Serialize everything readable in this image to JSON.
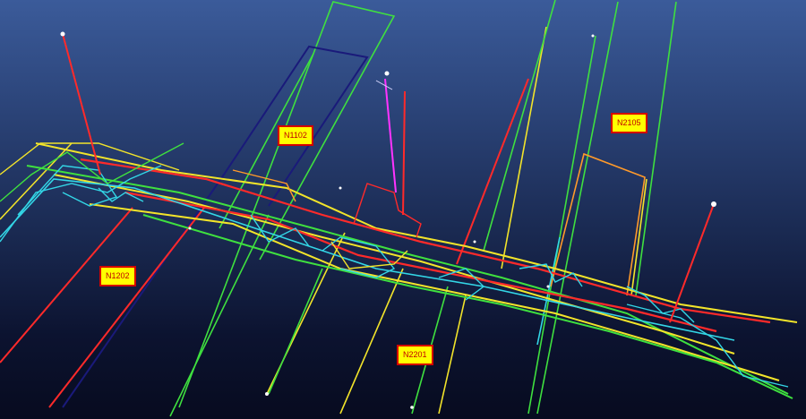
{
  "viewer": {
    "background_top": "#3b5b9a",
    "background_bottom": "#070b1f"
  },
  "panels": [
    {
      "id": "n1102",
      "label": "N1102"
    },
    {
      "id": "n2105",
      "label": "N2105"
    },
    {
      "id": "n1202",
      "label": "N1202"
    },
    {
      "id": "n2201",
      "label": "N2201"
    }
  ],
  "line_colors": {
    "roadway_red": "#ff2a2a",
    "roadway_yellow": "#f2e42a",
    "roadway_green": "#3fe03f",
    "roadway_cyan": "#33d6e6",
    "roadway_orange": "#ff9a2a",
    "roadway_navy": "#1a1a7a",
    "borehole_magenta": "#ff33ff",
    "node_white": "#ffffff"
  }
}
